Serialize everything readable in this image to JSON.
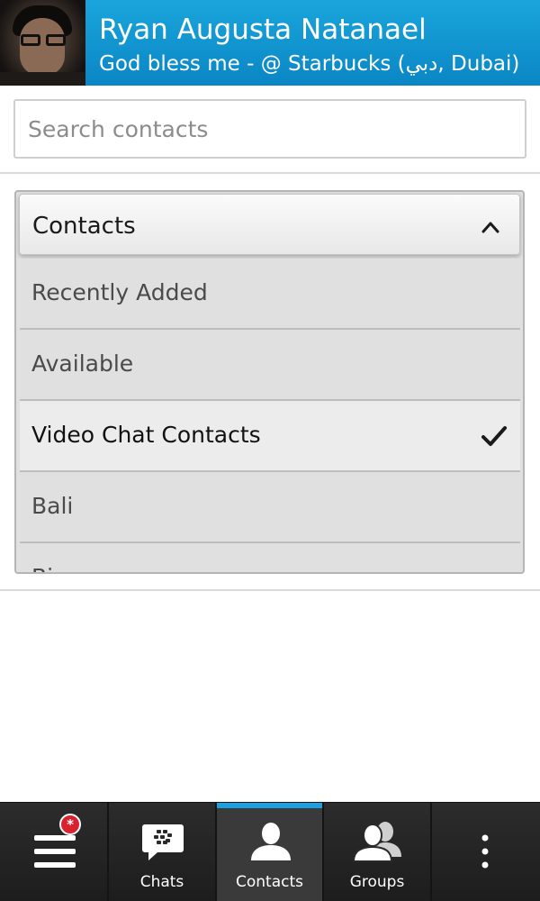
{
  "profile": {
    "name": "Ryan Augusta Natanael",
    "status": "God bless me - @ Starbucks (دبي, Dubai)"
  },
  "search": {
    "placeholder": "Search contacts",
    "value": ""
  },
  "dropdown": {
    "label": "Contacts",
    "expanded": true,
    "items": [
      {
        "label": "Recently Added",
        "selected": false
      },
      {
        "label": "Available",
        "selected": false
      },
      {
        "label": "Video Chat Contacts",
        "selected": true
      },
      {
        "label": "Bali",
        "selected": false
      },
      {
        "label": "Bi",
        "selected": false
      }
    ]
  },
  "bottom_bar": {
    "menu_badge": "*",
    "tabs": [
      {
        "label": "Chats",
        "icon": "bbm-chat-icon",
        "active": false
      },
      {
        "label": "Contacts",
        "icon": "contact-person-icon",
        "active": true
      },
      {
        "label": "Groups",
        "icon": "groups-icon",
        "active": false
      }
    ]
  },
  "colors": {
    "header_blue": "#0a86c4",
    "active_tab_accent": "#1ba1e2",
    "badge_red": "#d8222d"
  }
}
